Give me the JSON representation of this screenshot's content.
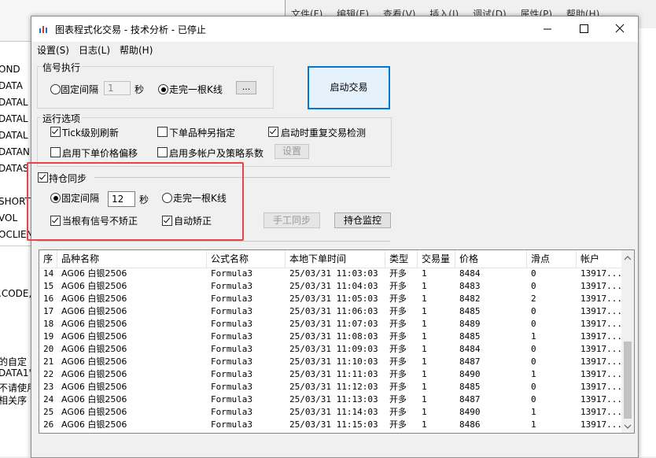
{
  "background": {
    "left_lines": [
      "OND",
      "DATA",
      "DATAL",
      "DATAL",
      "DATAL",
      "DATAN",
      "DATAS",
      "SHORT",
      "VOL",
      "OCLIEN",
      ",CODE,",
      "的自定",
      "DATA1'",
      "不请使用",
      "相关序"
    ],
    "menu": [
      "文件(F)",
      "编辑(E)",
      "查看(V)",
      "插入(I)",
      "调试(D)",
      "属性(P)",
      "帮助(H)"
    ]
  },
  "window": {
    "title": "图表程式化交易 - 技术分析 - 已停止",
    "menu": [
      "设置(S)",
      "日志(L)",
      "帮助(H)"
    ]
  },
  "signal": {
    "legend": "信号执行",
    "fixed_interval_label": "固定间隔",
    "fixed_interval_value": "1",
    "seconds_label": "秒",
    "bar_complete_label": "走完一根K线",
    "more_button": "...",
    "start_button": "启动交易"
  },
  "run_options": {
    "legend": "运行选项",
    "tick_refresh": "Tick级别刷新",
    "order_instrument": "下单品种另指定",
    "recheck_on_start": "启动时重复交易检测",
    "price_offset": "启用下单价格偏移",
    "multi_account": "启用多帐户及策略系数",
    "settings_button": "设置"
  },
  "position_sync": {
    "legend": "持仓同步",
    "fixed_interval_label": "固定间隔",
    "interval_value": "12",
    "seconds_label": "秒",
    "bar_complete_label": "走完一根K线",
    "no_correct_on_signal": "当根有信号不矫正",
    "auto_correct": "自动矫正",
    "manual_sync_button": "手工同步",
    "monitor_button": "持仓监控"
  },
  "table": {
    "columns": [
      "序",
      "品种名称",
      "公式名称",
      "本地下单时间",
      "类型",
      "交易量",
      "价格",
      "滑点",
      "帐户"
    ],
    "rows": [
      [
        "14",
        "AG06 白银2506",
        "Formula3",
        "25/03/31 11:03:03",
        "开多",
        "1",
        "8484",
        "0",
        "13917..."
      ],
      [
        "15",
        "AG06 白银2506",
        "Formula3",
        "25/03/31 11:04:03",
        "开多",
        "1",
        "8483",
        "0",
        "13917..."
      ],
      [
        "16",
        "AG06 白银2506",
        "Formula3",
        "25/03/31 11:05:03",
        "开多",
        "1",
        "8482",
        "2",
        "13917..."
      ],
      [
        "17",
        "AG06 白银2506",
        "Formula3",
        "25/03/31 11:06:03",
        "开多",
        "1",
        "8485",
        "0",
        "13917..."
      ],
      [
        "18",
        "AG06 白银2506",
        "Formula3",
        "25/03/31 11:07:03",
        "开多",
        "1",
        "8489",
        "0",
        "13917..."
      ],
      [
        "19",
        "AG06 白银2506",
        "Formula3",
        "25/03/31 11:08:03",
        "开多",
        "1",
        "8485",
        "1",
        "13917..."
      ],
      [
        "20",
        "AG06 白银2506",
        "Formula3",
        "25/03/31 11:09:03",
        "开多",
        "1",
        "8484",
        "0",
        "13917..."
      ],
      [
        "21",
        "AG06 白银2506",
        "Formula3",
        "25/03/31 11:10:03",
        "开多",
        "1",
        "8487",
        "0",
        "13917..."
      ],
      [
        "22",
        "AG06 白银2506",
        "Formula3",
        "25/03/31 11:11:03",
        "开多",
        "1",
        "8490",
        "1",
        "13917..."
      ],
      [
        "23",
        "AG06 白银2506",
        "Formula3",
        "25/03/31 11:12:03",
        "开多",
        "1",
        "8485",
        "0",
        "13917..."
      ],
      [
        "24",
        "AG06 白银2506",
        "Formula3",
        "25/03/31 11:13:03",
        "开多",
        "1",
        "8487",
        "0",
        "13917..."
      ],
      [
        "25",
        "AG06 白银2506",
        "Formula3",
        "25/03/31 11:14:03",
        "开多",
        "1",
        "8490",
        "1",
        "13917..."
      ],
      [
        "26",
        "AG06 白银2506",
        "Formula3",
        "25/03/31 11:15:03",
        "开多",
        "1",
        "8486",
        "1",
        "13917..."
      ]
    ]
  },
  "colors": {
    "highlight": "#e8434b",
    "accent": "#0078d7"
  }
}
